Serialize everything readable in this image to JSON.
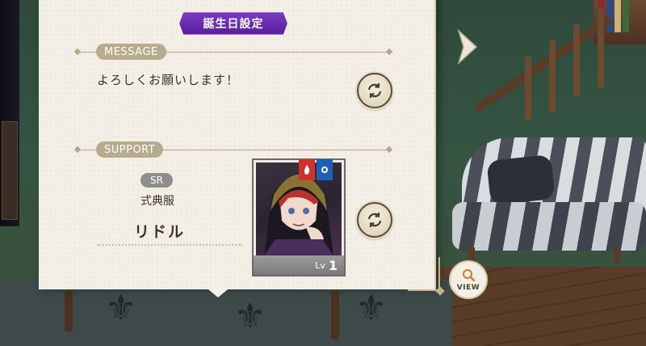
{
  "header": {
    "birthday_button": "誕生日設定"
  },
  "message_section": {
    "label": "MESSAGE",
    "text": "よろしくお願いします！"
  },
  "support_section": {
    "label": "SUPPORT",
    "card": {
      "rarity": "SR",
      "outfit": "式典服",
      "name": "リドル",
      "level_label": "Lv",
      "level": "1",
      "attributes": [
        "fire-icon",
        "water-icon"
      ]
    }
  },
  "navigation": {
    "next_icon": "chevron-right-icon",
    "view_label": "VIEW"
  },
  "colors": {
    "accent_purple": "#6a2cb0",
    "section_label_bg": "#b7ab8e",
    "panel_bg": "#f3efe6",
    "rarity_bg": "#8e8e8e"
  }
}
